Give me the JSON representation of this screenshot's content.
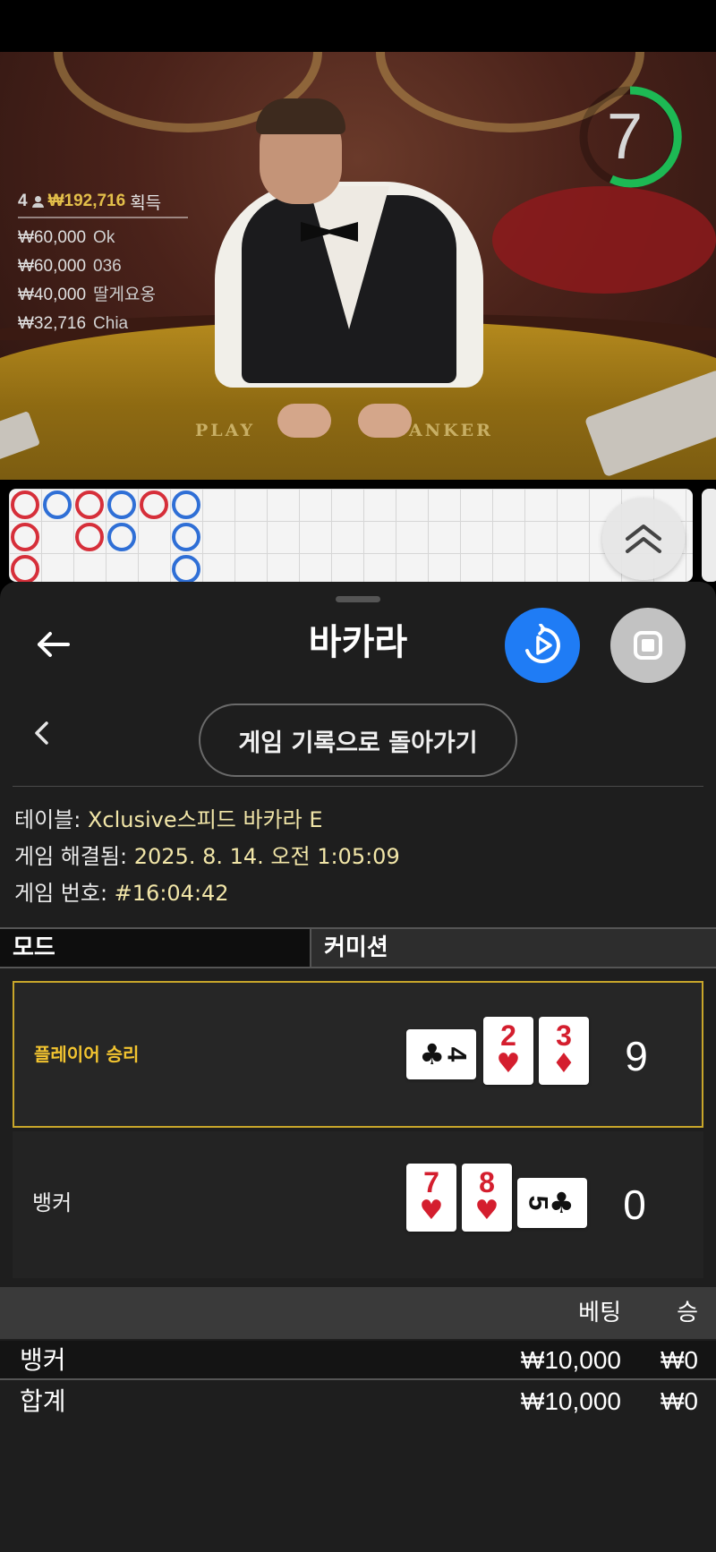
{
  "video": {
    "timer_value": "7",
    "felt_player": "PLAY",
    "felt_banker": "BANKER",
    "winners_summary": {
      "count": "4",
      "amount": "₩192,716",
      "label": "획득"
    },
    "winners": [
      {
        "amount": "₩60,000",
        "name": "Ok"
      },
      {
        "amount": "₩60,000",
        "name": "036"
      },
      {
        "amount": "₩40,000",
        "name": "딸게요옹"
      },
      {
        "amount": "₩32,716",
        "name": "Chia"
      }
    ]
  },
  "roadmap": {
    "columns": [
      [
        "banker",
        "banker",
        "banker"
      ],
      [
        "player"
      ],
      [
        "banker",
        "banker"
      ],
      [
        "player",
        "player"
      ],
      [
        "banker"
      ],
      [
        "player",
        "player",
        "player"
      ]
    ]
  },
  "header": {
    "title": "바카라"
  },
  "history_button": "게임 기록으로 돌아가기",
  "info": {
    "table_label": "테이블: ",
    "table_value": "Xclusive스피드 바카라 E",
    "resolved_label": "게임 해결됨: ",
    "resolved_value": "2025. 8. 14. 오전 1:05:09",
    "number_label": "게임 번호: ",
    "number_value": "#16:04:42"
  },
  "mode_header": {
    "mode": "모드",
    "commission": "커미션"
  },
  "results": {
    "player": {
      "label": "플레이어 승리",
      "score": "9",
      "cards": [
        {
          "rank": "4",
          "suit": "♣",
          "color": "black",
          "orientation": "sideways"
        },
        {
          "rank": "2",
          "suit": "♥",
          "color": "red",
          "orientation": "upright"
        },
        {
          "rank": "3",
          "suit": "♦",
          "color": "red",
          "orientation": "upright"
        }
      ]
    },
    "banker": {
      "label": "뱅커",
      "score": "0",
      "cards": [
        {
          "rank": "7",
          "suit": "♥",
          "color": "red",
          "orientation": "upright"
        },
        {
          "rank": "8",
          "suit": "♥",
          "color": "red",
          "orientation": "upright"
        },
        {
          "rank": "5",
          "suit": "♣",
          "color": "black",
          "orientation": "sideways"
        }
      ]
    }
  },
  "bets": {
    "headers": {
      "bet": "베팅",
      "win": "승"
    },
    "rows": [
      {
        "label": "뱅커",
        "bet": "₩10,000",
        "win": "₩0"
      },
      {
        "label": "합계",
        "bet": "₩10,000",
        "win": "₩0"
      }
    ]
  },
  "colors": {
    "accent_blue": "#1f7cf5",
    "player_win_gold": "#f2c430",
    "value_text": "#f2e6a8",
    "timer_green": "#1db954"
  }
}
